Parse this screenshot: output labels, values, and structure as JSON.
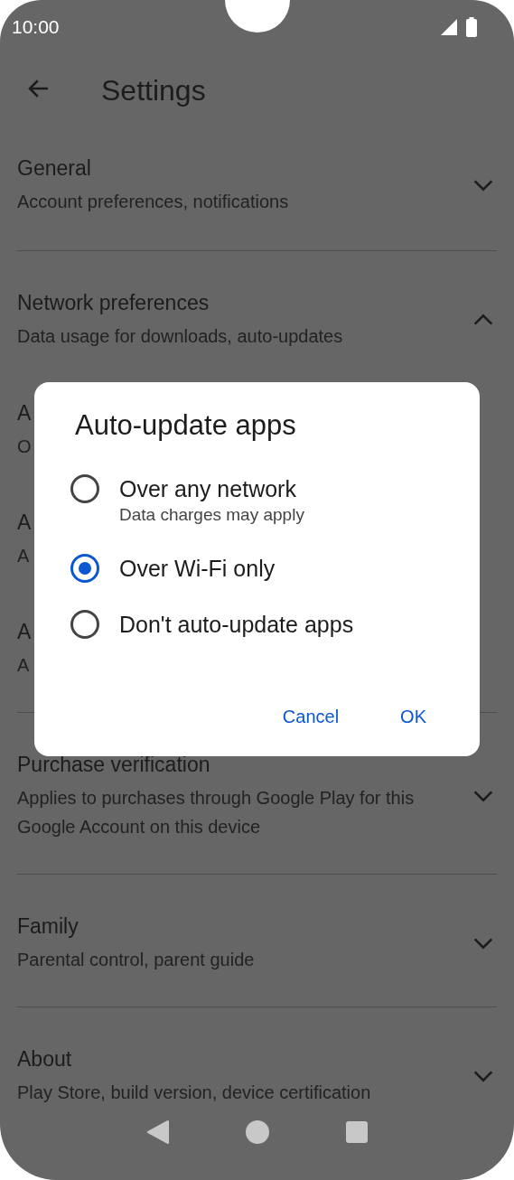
{
  "status_bar": {
    "time": "10:00"
  },
  "toolbar": {
    "title": "Settings"
  },
  "sections": [
    {
      "title": "General",
      "subtitle": "Account preferences, notifications",
      "expanded": false
    },
    {
      "title": "Network preferences",
      "subtitle": "Data usage for downloads, auto-updates",
      "expanded": true,
      "children": [
        {
          "title": "A",
          "subtitle": "O"
        },
        {
          "title": "A",
          "subtitle": "A"
        },
        {
          "title": "A",
          "subtitle": "A"
        }
      ]
    },
    {
      "title": "Purchase verification",
      "subtitle": "Applies to purchases through Google Play for this Google Account on this device",
      "expanded": false
    },
    {
      "title": "Family",
      "subtitle": "Parental control, parent guide",
      "expanded": false
    },
    {
      "title": "About",
      "subtitle": "Play Store, build version, device certification",
      "expanded": false
    }
  ],
  "dialog": {
    "title": "Auto-update apps",
    "options": [
      {
        "label": "Over any network",
        "description": "Data charges may apply",
        "selected": false
      },
      {
        "label": "Over Wi-Fi only",
        "selected": true
      },
      {
        "label": "Don't auto-update apps",
        "selected": false
      }
    ],
    "buttons": [
      "Cancel",
      "OK"
    ]
  }
}
